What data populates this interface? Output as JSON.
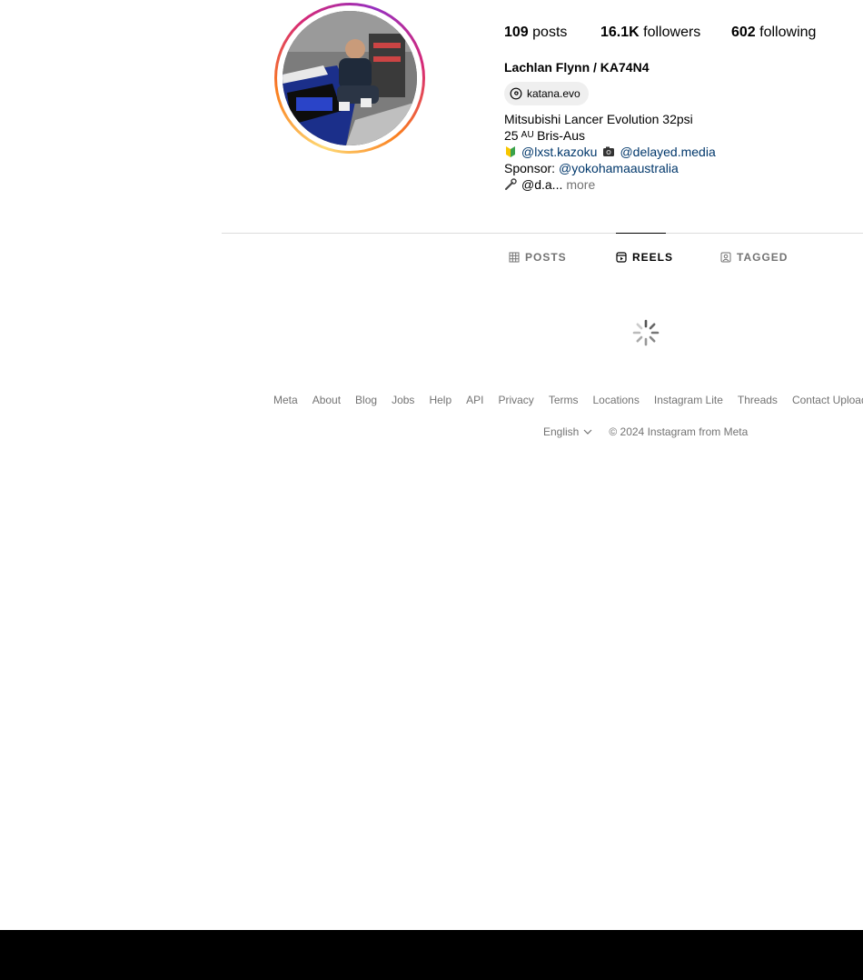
{
  "profile": {
    "stats": {
      "posts_count": "109",
      "posts_label": "posts",
      "followers_count": "16.1K",
      "followers_label": "followers",
      "following_count": "602",
      "following_label": "following"
    },
    "full_name": "Lachlan Flynn / KA74N4",
    "threads_handle": "katana.evo",
    "bio": {
      "line1": "Mitsubishi Lancer Evolution 32psi",
      "line2_prefix": "25",
      "line2_flag": "AU",
      "line2_suffix": "Bris-Aus",
      "mention1": "@lxst.kazoku",
      "mention2": "@delayed.media",
      "sponsor_label": "Sponsor:",
      "sponsor_mention": "@yokohamaaustralia",
      "line5_text": "@d.a...",
      "more_label": "more"
    }
  },
  "tabs": [
    {
      "label": "POSTS",
      "icon": "grid-icon",
      "active": false
    },
    {
      "label": "REELS",
      "icon": "reels-icon",
      "active": true
    },
    {
      "label": "TAGGED",
      "icon": "tagged-icon",
      "active": false
    }
  ],
  "footer": {
    "links": [
      "Meta",
      "About",
      "Blog",
      "Jobs",
      "Help",
      "API",
      "Privacy",
      "Terms",
      "Locations",
      "Instagram Lite",
      "Threads",
      "Contact Uploading"
    ],
    "language": "English",
    "copyright": "© 2024 Instagram from Meta"
  },
  "colors": {
    "mention": "#00376b",
    "muted": "#737373",
    "divider": "#dbdbdb"
  }
}
